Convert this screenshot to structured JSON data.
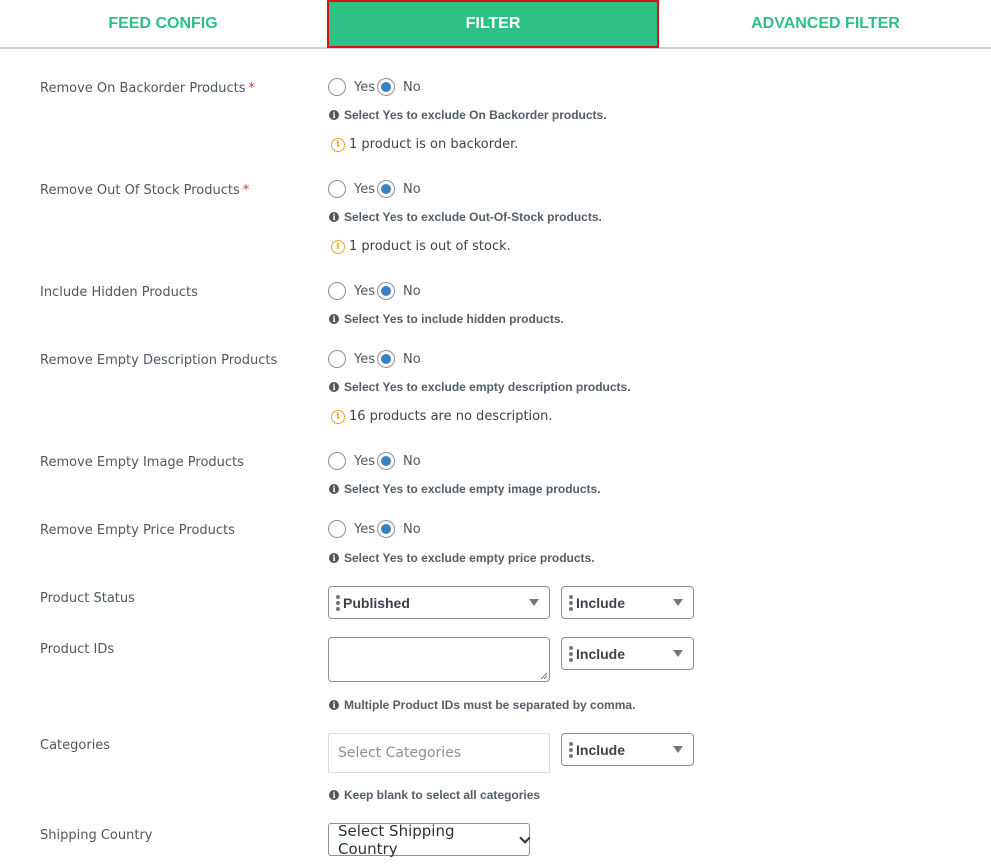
{
  "tabs": [
    {
      "label": "FEED CONFIG",
      "active": false
    },
    {
      "label": "FILTER",
      "active": true
    },
    {
      "label": "ADVANCED FILTER",
      "active": false
    }
  ],
  "colors": {
    "accent": "#2dc185",
    "active_border": "#d61414",
    "radio_checked": "#3582c4",
    "warning": "#f0a330",
    "required": "#d63638"
  },
  "radio_options": {
    "yes": "Yes",
    "no": "No"
  },
  "fields": [
    {
      "label": "Remove On Backorder Products",
      "required": true,
      "selected": "No",
      "hint": "Select Yes to exclude On Backorder products.",
      "notice": "1 product is on backorder."
    },
    {
      "label": "Remove Out Of Stock Products",
      "required": true,
      "selected": "No",
      "hint": "Select Yes to exclude Out-Of-Stock products.",
      "notice": "1 product is out of stock."
    },
    {
      "label": "Include Hidden Products",
      "required": false,
      "selected": "No",
      "hint": "Select Yes to include hidden products."
    },
    {
      "label": "Remove Empty Description Products",
      "required": false,
      "selected": "No",
      "hint": "Select Yes to exclude empty description products.",
      "notice": "16 products are no description."
    },
    {
      "label": "Remove Empty Image Products",
      "required": false,
      "selected": "No",
      "hint": "Select Yes to exclude empty image products."
    },
    {
      "label": "Remove Empty Price Products",
      "required": false,
      "selected": "No",
      "hint": "Select Yes to exclude empty price products."
    }
  ],
  "required_mark": "*",
  "product_status": {
    "label": "Product Status",
    "value": "Published",
    "condition": "Include"
  },
  "product_ids": {
    "label": "Product IDs",
    "value": "",
    "condition": "Include",
    "hint": "Multiple Product IDs must be separated by comma."
  },
  "categories": {
    "label": "Categories",
    "placeholder": "Select Categories",
    "condition": "Include",
    "hint": "Keep blank to select all categories"
  },
  "shipping_country": {
    "label": "Shipping Country",
    "value": "Select Shipping Country"
  },
  "icons": {
    "info": "i",
    "warning": "i"
  }
}
